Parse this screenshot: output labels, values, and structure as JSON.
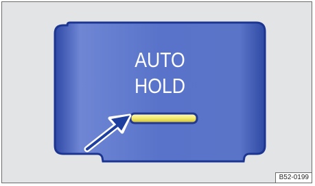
{
  "button": {
    "line1": "AUTO",
    "line2": "HOLD",
    "indicator_color": "#f2e96a"
  },
  "figure_code": "B52-0199",
  "colors": {
    "background": "#e3e4e5",
    "button_blue": "#4a64c0",
    "arrow": "#1f3f9e"
  }
}
